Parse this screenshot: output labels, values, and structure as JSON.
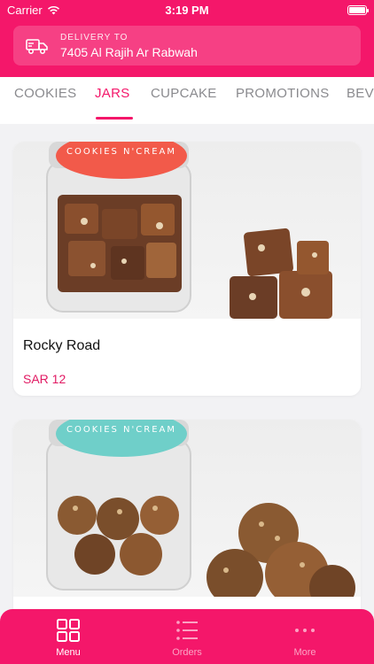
{
  "status_bar": {
    "carrier": "Carrier",
    "time": "3:19 PM"
  },
  "delivery": {
    "label": "DELIVERY TO",
    "address": "7405 Al Rajih Ar Rabwah"
  },
  "tabs": [
    {
      "label": "COOKIES"
    },
    {
      "label": "JARS"
    },
    {
      "label": "CUPCAKE"
    },
    {
      "label": "PROMOTIONS"
    },
    {
      "label": "BEV"
    }
  ],
  "active_tab": "JARS",
  "products": [
    {
      "name": "Rocky Road",
      "price": "SAR 12",
      "jar_label": "COOKIES N'CREAM",
      "lid_color": "#f25a4a"
    },
    {
      "name": "",
      "price": "",
      "jar_label": "COOKIES N'CREAM",
      "lid_color": "#6fcfc9"
    }
  ],
  "bottom_nav": [
    {
      "label": "Menu",
      "icon": "grid-icon",
      "active": true
    },
    {
      "label": "Orders",
      "icon": "list-icon",
      "active": false
    },
    {
      "label": "More",
      "icon": "more-dots-icon",
      "active": false
    }
  ],
  "colors": {
    "brand": "#f4176a",
    "price": "#e11a63"
  }
}
